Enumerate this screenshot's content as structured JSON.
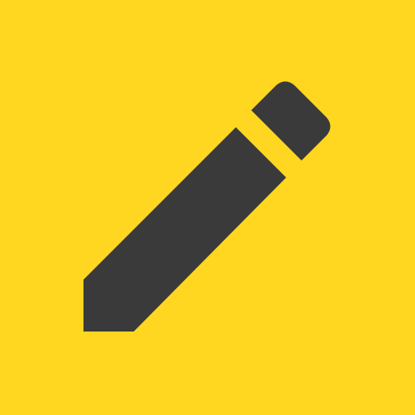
{
  "icon": {
    "name": "pencil-icon",
    "background_color": "#FFD620",
    "glyph_color": "#3A3A3A"
  }
}
